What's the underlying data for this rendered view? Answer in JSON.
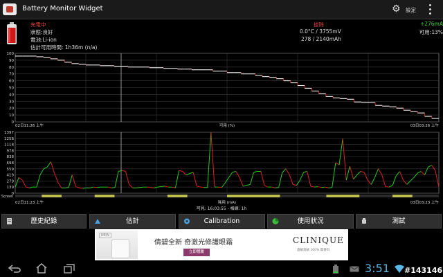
{
  "app": {
    "title": "Battery Monitor Widget",
    "settings_label": "設定"
  },
  "status": {
    "state": "充電中",
    "health": "狀態:良好",
    "technology": "電池:Li-ion",
    "estimate": "估計可用時間: 1h36m (n/a)",
    "plug": "拔除",
    "temp_voltage": "0.0°C / 3755mV",
    "current_capacity": "278 / 2140mAh",
    "delta_current": "+276mA",
    "available": "可用:13%"
  },
  "colors": {
    "level_line": "#e02020",
    "current_charging": "#22cc22",
    "current_discharging": "#e02020",
    "grid": "#3a3a3a"
  },
  "chart_data": [
    {
      "type": "line",
      "title": "",
      "xlabel": "可用 (%)",
      "ylabel": "",
      "x_start_label": "02日11:26 上午",
      "x_end_label": "03日03:26 上午",
      "ylim": [
        0,
        100
      ],
      "ticks": [
        "100",
        "90",
        "80",
        "70",
        "60",
        "50",
        "40",
        "30",
        "20",
        "10",
        "0"
      ],
      "grid": true,
      "series": [
        {
          "values": [
            96,
            96,
            96,
            95,
            94,
            92,
            90,
            87,
            85,
            84,
            83,
            83,
            82,
            82,
            81,
            81,
            80,
            80,
            80,
            79,
            79,
            78,
            78,
            77,
            77,
            76,
            76,
            76,
            74,
            74,
            72,
            72,
            70,
            70,
            68,
            66,
            65,
            63,
            60,
            57,
            53,
            49,
            45,
            41,
            37,
            35,
            34,
            33,
            29,
            28,
            28,
            24,
            23,
            22,
            20,
            17,
            15,
            13,
            8,
            5,
            5
          ]
        }
      ]
    },
    {
      "type": "line",
      "title": "",
      "xlabel": "耗用 (mA)",
      "ylabel": "",
      "x_start_label": "02日11:23 上午",
      "x_end_label": "03日03:23 上午",
      "ylim": [
        0,
        1397
      ],
      "ticks": [
        "1397",
        "1258",
        "1118",
        "978",
        "838",
        "698",
        "559",
        "419",
        "279",
        "139",
        "0"
      ],
      "extra_row_label": "Screen",
      "footer": "可見: 16:03:55 - 格線: 1h",
      "grid": true,
      "series": [
        {
          "values": [
            139,
            360,
            300,
            140,
            120,
            140,
            140,
            420,
            560,
            600,
            720,
            460,
            250,
            120,
            120,
            130,
            420,
            150,
            120,
            110,
            120,
            120,
            140,
            130,
            140,
            140,
            140,
            120,
            130,
            500,
            520,
            500,
            200,
            120,
            120,
            130,
            140,
            140,
            130,
            120,
            140,
            150,
            160,
            140,
            140,
            120,
            520,
            500,
            420,
            450,
            480,
            160,
            140,
            130,
            130,
            1390,
            140,
            140,
            130,
            240,
            360,
            480,
            500,
            360,
            160,
            180,
            200,
            480,
            500,
            500,
            180,
            140,
            140,
            120,
            130,
            470,
            560,
            430,
            200,
            180,
            300,
            480,
            500,
            160,
            140,
            150,
            130,
            140,
            120,
            130,
            700,
            650,
            1250,
            300,
            620,
            320,
            420,
            500,
            480,
            300,
            200,
            360,
            560,
            420,
            150,
            140,
            180,
            400,
            500,
            300,
            200,
            280,
            360,
            460,
            500,
            420,
            600,
            640,
            520,
            140
          ]
        }
      ]
    }
  ],
  "buttons": [
    {
      "label": "歷史紀錄",
      "icon": "history-icon"
    },
    {
      "label": "估計",
      "icon": "estimate-icon"
    },
    {
      "label": "Calibration",
      "icon": "calibration-icon"
    },
    {
      "label": "使用狀況",
      "icon": "usage-icon"
    },
    {
      "label": "測試",
      "icon": "test-icon"
    }
  ],
  "ad": {
    "badge": "NEW",
    "headline": "倩碧全新 奇激光修護眼霜",
    "cta": "立即體驗",
    "brand": "CLINIQUE",
    "sub": "過敏測試 100% 無香料"
  },
  "system": {
    "time": "3:51",
    "watermark": "#143146"
  }
}
